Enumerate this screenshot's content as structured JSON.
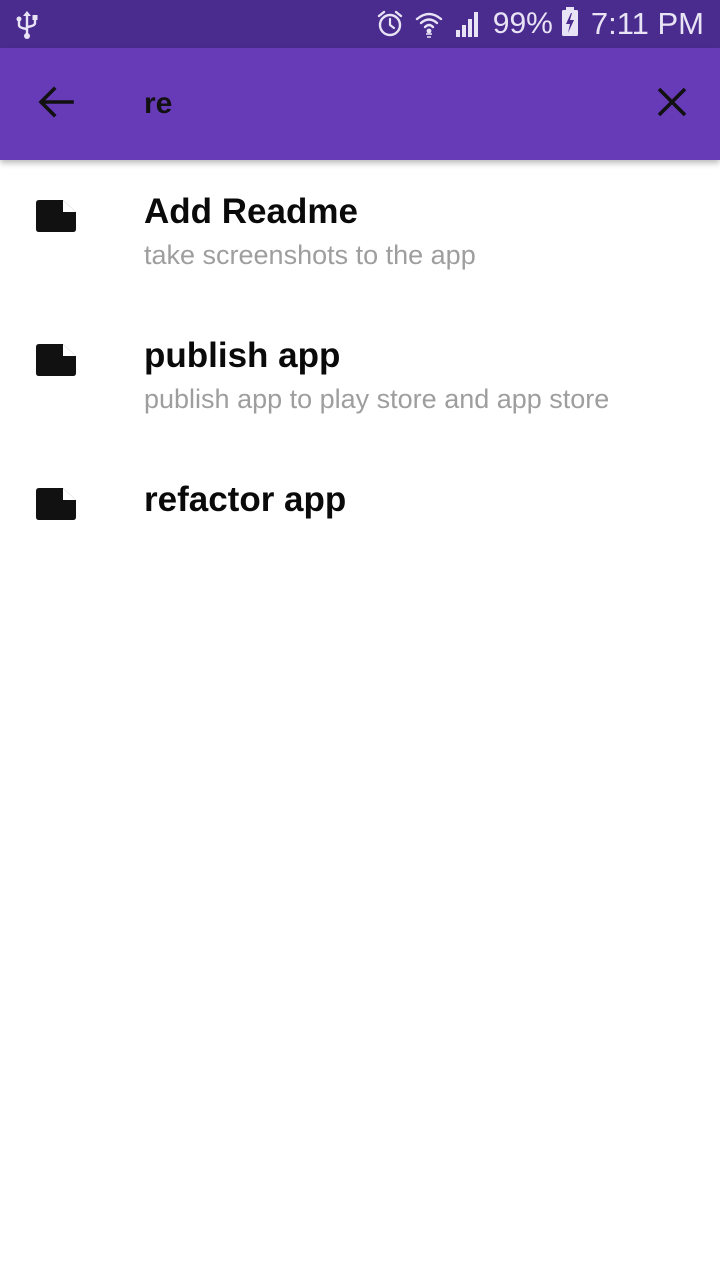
{
  "status_bar": {
    "usb_icon": "usb-icon",
    "alarm_icon": "alarm-icon",
    "wifi_icon": "wifi-icon",
    "signal_icon": "signal-icon",
    "battery_percent": "99%",
    "battery_icon": "battery-charging-icon",
    "time": "7:11 PM"
  },
  "app_bar": {
    "background": "#673ab7",
    "back_icon": "arrow-back-icon",
    "search_value": "re",
    "clear_icon": "close-icon"
  },
  "results": [
    {
      "icon": "note-icon",
      "title": "Add Readme",
      "subtitle": "take screenshots to the app"
    },
    {
      "icon": "note-icon",
      "title": "publish app",
      "subtitle": "publish app to play store and app store"
    },
    {
      "icon": "note-icon",
      "title": "refactor app",
      "subtitle": ""
    }
  ]
}
